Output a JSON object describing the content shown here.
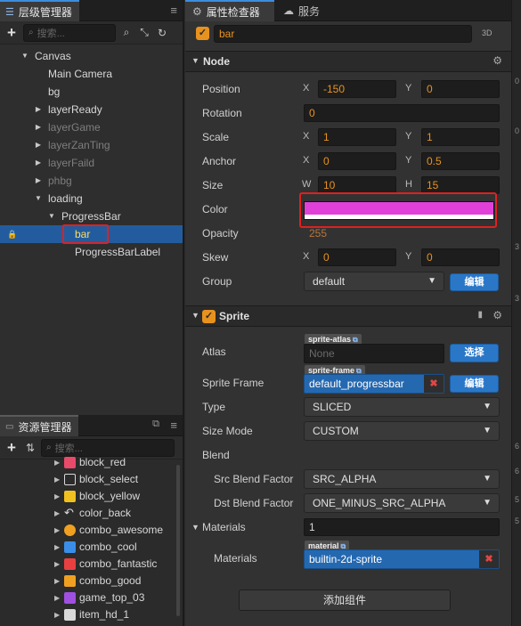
{
  "hierarchy": {
    "title": "层级管理器",
    "search_placeholder": "搜索...",
    "nodes": [
      {
        "label": "Canvas"
      },
      {
        "label": "Main Camera"
      },
      {
        "label": "bg"
      },
      {
        "label": "layerReady"
      },
      {
        "label": "layerGame"
      },
      {
        "label": "layerZanTing"
      },
      {
        "label": "layerFaild"
      },
      {
        "label": "phbg"
      },
      {
        "label": "loading"
      },
      {
        "label": "ProgressBar"
      },
      {
        "label": "bar"
      },
      {
        "label": "ProgressBarLabel"
      }
    ]
  },
  "assets": {
    "title": "资源管理器",
    "search_placeholder": "搜索...",
    "items": [
      {
        "label": "block_red",
        "color": "#e84a6a"
      },
      {
        "label": "block_select",
        "color": "#d8d8d8"
      },
      {
        "label": "block_yellow",
        "color": "#f0c020"
      },
      {
        "label": "color_back",
        "color": "#d8d8d8"
      },
      {
        "label": "combo_awesome",
        "color": "#f0a020"
      },
      {
        "label": "combo_cool",
        "color": "#3a8ee8"
      },
      {
        "label": "combo_fantastic",
        "color": "#e84040"
      },
      {
        "label": "combo_good",
        "color": "#f0a020"
      },
      {
        "label": "game_top_03",
        "color": "#a050e0"
      },
      {
        "label": "item_hd_1",
        "color": "#d8d8d8"
      }
    ]
  },
  "inspector": {
    "tab_label": "属性检查器",
    "service_tab": "服务",
    "node_name": "bar",
    "tag_3d": "3D",
    "node_section": {
      "title": "Node",
      "position": {
        "label": "Position",
        "x_axis": "X",
        "x": "-150",
        "y_axis": "Y",
        "y": "0"
      },
      "rotation": {
        "label": "Rotation",
        "value": "0"
      },
      "scale": {
        "label": "Scale",
        "x_axis": "X",
        "x": "1",
        "y_axis": "Y",
        "y": "1"
      },
      "anchor": {
        "label": "Anchor",
        "x_axis": "X",
        "x": "0",
        "y_axis": "Y",
        "y": "0.5"
      },
      "size": {
        "label": "Size",
        "w_axis": "W",
        "w": "10",
        "h_axis": "H",
        "h": "15"
      },
      "color": {
        "label": "Color",
        "value": "#e040d8"
      },
      "opacity": {
        "label": "Opacity",
        "value": "255"
      },
      "skew": {
        "label": "Skew",
        "x_axis": "X",
        "x": "0",
        "y_axis": "Y",
        "y": "0"
      },
      "group": {
        "label": "Group",
        "value": "default",
        "edit_button": "编辑"
      }
    },
    "sprite_section": {
      "title": "Sprite",
      "atlas": {
        "label": "Atlas",
        "badge": "sprite-atlas",
        "value": "None",
        "select_button": "选择"
      },
      "sprite_frame": {
        "label": "Sprite Frame",
        "badge": "sprite-frame",
        "value": "default_progressbar",
        "edit_button": "编辑"
      },
      "type": {
        "label": "Type",
        "value": "SLICED"
      },
      "size_mode": {
        "label": "Size Mode",
        "value": "CUSTOM"
      },
      "blend": {
        "label": "Blend"
      },
      "src_blend": {
        "label": "Src Blend Factor",
        "value": "SRC_ALPHA"
      },
      "dst_blend": {
        "label": "Dst Blend Factor",
        "value": "ONE_MINUS_SRC_ALPHA"
      },
      "materials_header": {
        "label": "Materials",
        "count": "1"
      },
      "materials": {
        "label": "Materials",
        "badge": "material",
        "value": "builtin-2d-sprite"
      }
    },
    "add_component_button": "添加组件"
  },
  "far_right_ticks": [
    "0",
    "0",
    "3",
    "3",
    "6",
    "6",
    "5",
    "5"
  ]
}
